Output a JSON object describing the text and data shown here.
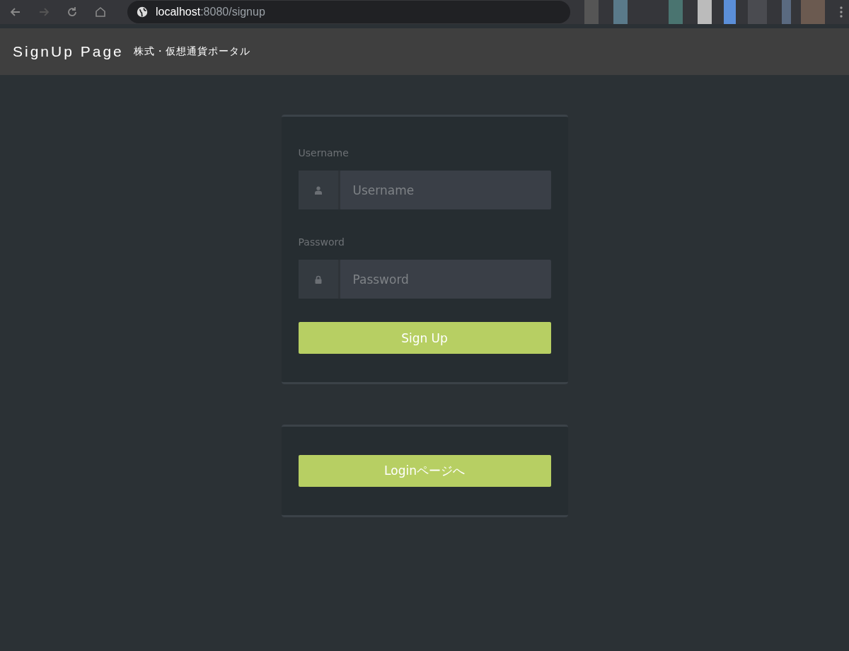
{
  "browser": {
    "url": "**localhost**:8080/signup"
  },
  "header": {
    "title": "SignUp Page",
    "subtitle": "株式・仮想通貨ポータル"
  },
  "signup_form": {
    "fields": [
      {
        "label": "Username",
        "placeholder": "Username",
        "kind": "user"
      },
      {
        "label": "Password",
        "placeholder": "Password",
        "kind": "lock"
      }
    ],
    "submit": "Sign Up"
  },
  "login_card": {
    "button": "Loginページへ"
  }
}
